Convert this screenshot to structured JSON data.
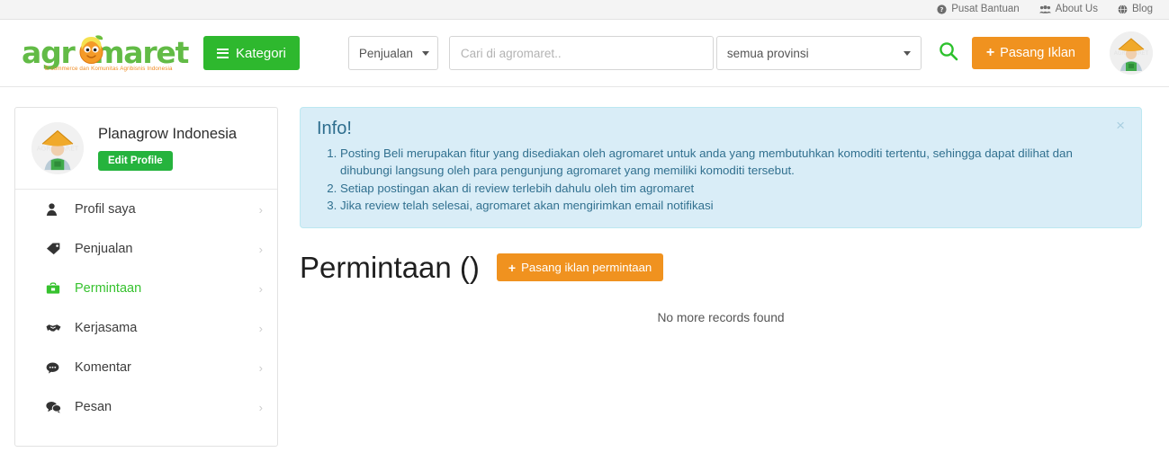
{
  "topbar": {
    "links": [
      {
        "label": "Pusat Bantuan",
        "icon": "question-circle-icon"
      },
      {
        "label": "About Us",
        "icon": "users-group-icon"
      },
      {
        "label": "Blog",
        "icon": "globe-icon"
      }
    ]
  },
  "header": {
    "logo_text": "agr",
    "logo_text2": "maret",
    "logo_tagline": "E-commerce dan Komunitas Agribisnis Indonesia",
    "kategori_label": "Kategori",
    "type_select_value": "Penjualan",
    "search_placeholder": "Cari di agromaret..",
    "search_value": "",
    "province_select_value": "semua provinsi",
    "search_icon": "search-icon",
    "pasang_iklan_label": "Pasang Iklan",
    "avatar_alt": "farmer-avatar"
  },
  "sidebar": {
    "profile_name": "Planagrow Indonesia",
    "edit_profile_label": "Edit Profile",
    "items": [
      {
        "label": "Profil saya",
        "icon": "user-icon",
        "active": false
      },
      {
        "label": "Penjualan",
        "icon": "tag-icon",
        "active": false
      },
      {
        "label": "Permintaan",
        "icon": "briefcase-icon",
        "active": true
      },
      {
        "label": "Kerjasama",
        "icon": "handshake-icon",
        "active": false
      },
      {
        "label": "Komentar",
        "icon": "comment-icon",
        "active": false
      },
      {
        "label": "Pesan",
        "icon": "comments-icon",
        "active": false
      }
    ],
    "chevron": "›"
  },
  "main": {
    "alert": {
      "title": "Info!",
      "close_label": "×",
      "items": [
        "Posting Beli merupakan fitur yang disediakan oleh agromaret untuk anda yang membutuhkan komoditi tertentu, sehingga dapat dilihat dan dihubungi langsung oleh para pengunjung agromaret yang memiliki komoditi tersebut.",
        "Setiap postingan akan di review terlebih dahulu oleh tim agromaret",
        "Jika review telah selesai, agromaret akan mengirimkan email notifikasi"
      ]
    },
    "page_title": "Permintaan ()",
    "pasang_iklan_permintaan_label": "Pasang iklan permintaan",
    "empty_message": "No more records found"
  },
  "colors": {
    "green": "#2eb82e",
    "green_active": "#36c22e",
    "orange": "#f0921f",
    "logo_green": "#62bb46",
    "info_bg": "#d9edf7",
    "info_border": "#bce8f1",
    "info_text": "#31708f"
  }
}
